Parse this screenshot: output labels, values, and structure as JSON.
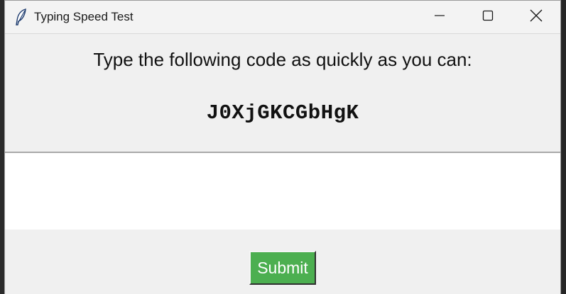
{
  "window": {
    "title": "Typing Speed Test"
  },
  "main": {
    "instruction": "Type the following code as quickly as you can:",
    "code": "J0XjGKCGbHgK",
    "input_value": ""
  },
  "actions": {
    "submit_label": "Submit"
  },
  "colors": {
    "submit_bg": "#4caf50",
    "window_bg": "#f0f0f0",
    "input_bg": "#ffffff"
  },
  "icons": [
    "feather-icon",
    "minimize-icon",
    "maximize-icon",
    "close-icon"
  ]
}
